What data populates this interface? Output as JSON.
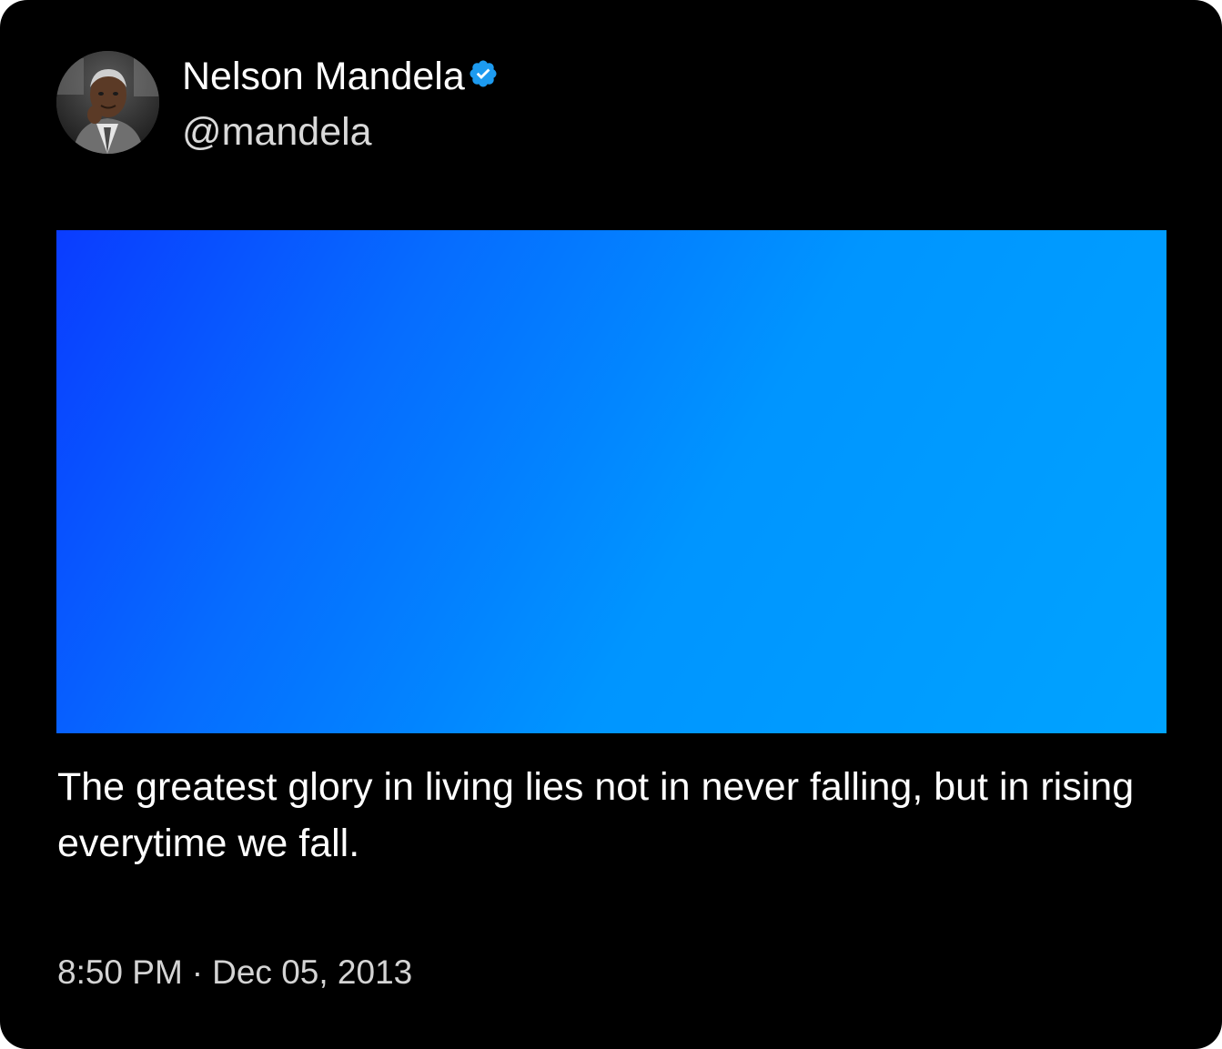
{
  "tweet": {
    "author": {
      "display_name": "Nelson Mandela",
      "handle": "@mandela",
      "verified_icon": "verified-badge-icon",
      "verified_color": "#1d9bf0"
    },
    "text": "The greatest glory in living lies not in never falling, but in rising everytime we fall.",
    "time": "8:50 PM",
    "separator": "·",
    "date": "Dec 05, 2013"
  },
  "colors": {
    "background": "#000000",
    "text_primary": "#ffffff",
    "text_secondary": "#d4d4d4",
    "media_gradient_start": "#0a3cff",
    "media_gradient_end": "#00a3ff"
  }
}
